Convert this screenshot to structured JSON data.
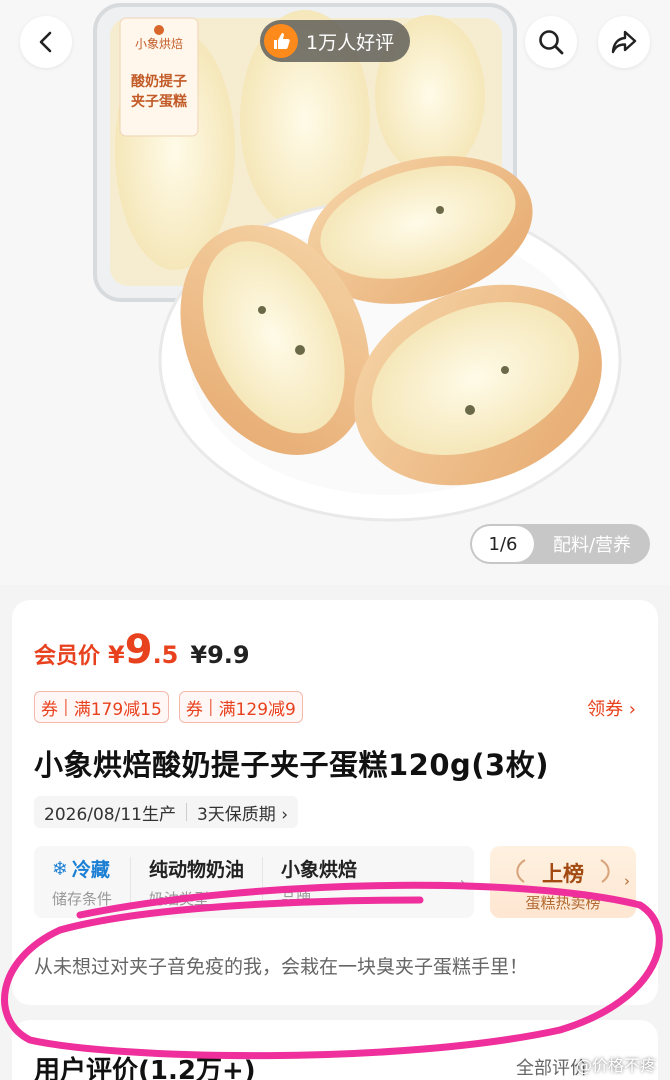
{
  "header": {
    "rating_badge": "1万人好评",
    "back_icon": "chevron-left-icon",
    "search_icon": "search-icon",
    "share_icon": "share-icon"
  },
  "gallery": {
    "counter": "1/6",
    "ingredients_tab": "配料/营养",
    "package_brand": "小象烘焙",
    "package_label_line1": "酸奶提子",
    "package_label_line2": "夹子蛋糕"
  },
  "price": {
    "member_label": "会员价",
    "currency": "¥",
    "integer": "9",
    "decimal": ".5",
    "original": "¥9.9"
  },
  "coupons": [
    {
      "tag": "券",
      "text": "满179减15"
    },
    {
      "tag": "券",
      "text": "满129减9"
    }
  ],
  "get_coupon": "领券 ›",
  "title": "小象烘焙酸奶提子夹子蛋糕120g(3枚)",
  "dates": {
    "production": "2026/08/11生产",
    "shelf_life": "3天保质期 ›"
  },
  "attributes": [
    {
      "value": "冷藏",
      "label": "储存条件"
    },
    {
      "value": "纯动物奶油",
      "label": "奶油类型"
    },
    {
      "value": "小象烘焙",
      "label": "品牌"
    }
  ],
  "rank": {
    "value": "上榜",
    "label": "蛋糕热卖榜"
  },
  "comment": "从未想过对夹子音免疫的我，会栽在一块臭夹子蛋糕手里！",
  "reviews": {
    "title": "用户评价(1.2万+)",
    "all": "全部评价"
  },
  "watermark": "@价格不疼",
  "colors": {
    "price_red": "#e8411e",
    "highlight_pink": "#ee2f9c",
    "cold_blue": "#1b7fd4"
  }
}
